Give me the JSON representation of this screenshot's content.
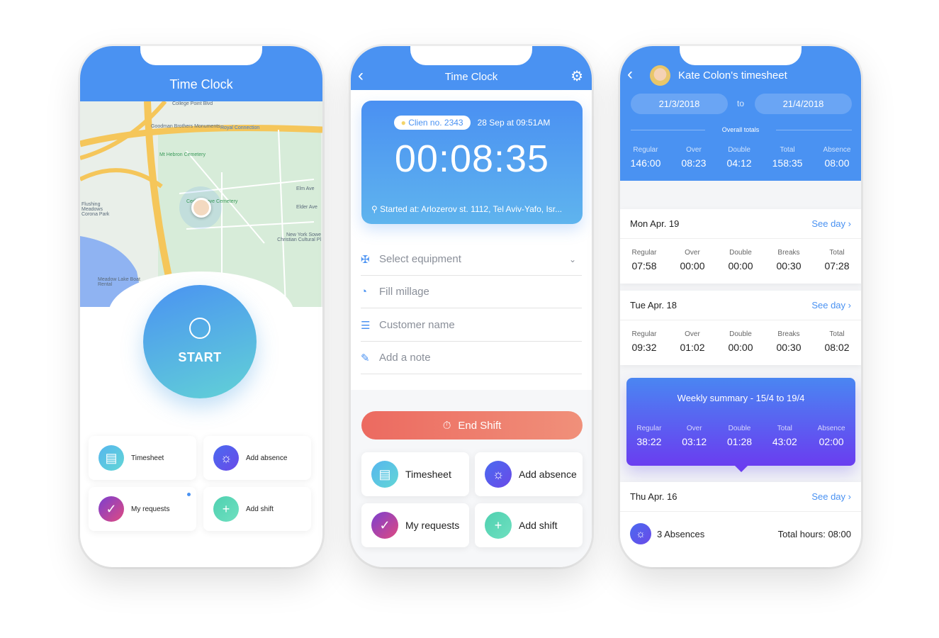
{
  "colors": {
    "primary": "#4a92f2",
    "end_shift": "#ec6e62",
    "weekly_gradient": [
      "#4a86f2",
      "#6a3df0"
    ]
  },
  "phone1": {
    "title": "Time Clock",
    "map_labels": [
      "College Point Blvd",
      "Goodman Brothers Monuments",
      "Royal Connection",
      "Mt Hebron Cemetery",
      "Cedar Grove Cemetery",
      "Flushing Meadows Corona Park",
      "New York Sowe Christian Cultural Pl",
      "Meadow Lake Boat Rental",
      "Elm Ave",
      "Elder Ave"
    ],
    "start_label": "START",
    "tiles": [
      {
        "label": "Timesheet",
        "icon": "calendar-icon"
      },
      {
        "label": "Add absence",
        "icon": "sun-icon"
      },
      {
        "label": "My requests",
        "icon": "check-icon",
        "has_notification": true
      },
      {
        "label": "Add shift",
        "icon": "plus-icon"
      }
    ]
  },
  "phone2": {
    "title": "Time Clock",
    "client_badge": "Clien no. 2343",
    "start_time": "28 Sep at 09:51AM",
    "timer": "00:08:35",
    "location": "Started at: Arlozerov st. 1112, Tel Aviv-Yafo, Isr...",
    "fields": [
      {
        "placeholder": "Select equipment",
        "icon": "equipment-icon",
        "dropdown": true
      },
      {
        "placeholder": "Fill millage",
        "icon": "gauge-icon"
      },
      {
        "placeholder": "Customer name",
        "icon": "list-icon"
      },
      {
        "placeholder": "Add a note",
        "icon": "edit-icon"
      }
    ],
    "end_shift": "End Shift",
    "tiles": [
      {
        "label": "Timesheet",
        "icon": "calendar-icon"
      },
      {
        "label": "Add absence",
        "icon": "sun-icon"
      },
      {
        "label": "My requests",
        "icon": "check-icon"
      },
      {
        "label": "Add shift",
        "icon": "plus-icon"
      }
    ]
  },
  "phone3": {
    "title": "Kate Colon's timesheet",
    "date_from": "21/3/2018",
    "to": "to",
    "date_to": "21/4/2018",
    "overall_label": "Overall totals",
    "overall": [
      {
        "l": "Regular",
        "v": "146:00"
      },
      {
        "l": "Over",
        "v": "08:23"
      },
      {
        "l": "Double",
        "v": "04:12"
      },
      {
        "l": "Total",
        "v": "158:35"
      },
      {
        "l": "Absence",
        "v": "08:00"
      }
    ],
    "see_day": "See day",
    "days": [
      {
        "date": "Mon Apr. 19",
        "stats": [
          {
            "l": "Regular",
            "v": "07:58"
          },
          {
            "l": "Over",
            "v": "00:00"
          },
          {
            "l": "Double",
            "v": "00:00"
          },
          {
            "l": "Breaks",
            "v": "00:30"
          },
          {
            "l": "Total",
            "v": "07:28"
          }
        ]
      },
      {
        "date": "Tue Apr. 18",
        "stats": [
          {
            "l": "Regular",
            "v": "09:32"
          },
          {
            "l": "Over",
            "v": "01:02"
          },
          {
            "l": "Double",
            "v": "00:00"
          },
          {
            "l": "Breaks",
            "v": "00:30"
          },
          {
            "l": "Total",
            "v": "08:02"
          }
        ]
      }
    ],
    "weekly": {
      "title": "Weekly summary - 15/4 to 19/4",
      "stats": [
        {
          "l": "Regular",
          "v": "38:22"
        },
        {
          "l": "Over",
          "v": "03:12"
        },
        {
          "l": "Double",
          "v": "01:28"
        },
        {
          "l": "Total",
          "v": "43:02"
        },
        {
          "l": "Absence",
          "v": "02:00"
        }
      ]
    },
    "thu": {
      "date": "Thu Apr. 16",
      "absences": "3 Absences",
      "total_hours": "Total hours: 08:00"
    }
  }
}
